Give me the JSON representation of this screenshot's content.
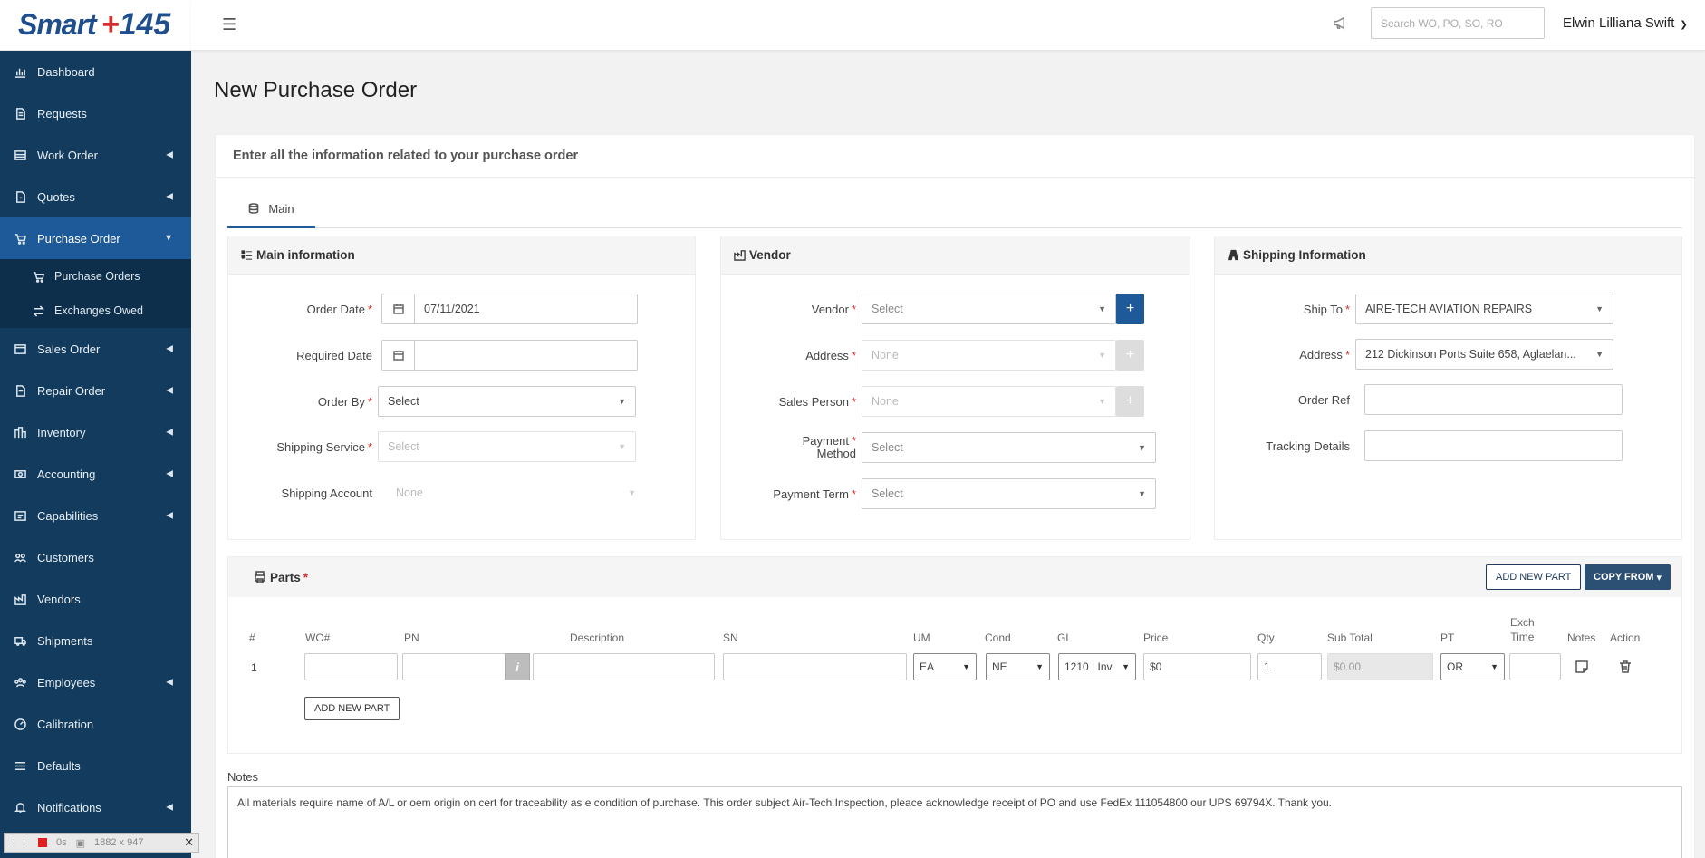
{
  "brand": {
    "name_part1": "Smart",
    "name_plus": "+",
    "name_part2": "145"
  },
  "topbar": {
    "search_placeholder": "Search WO, PO, SO, RO",
    "user_name": "Elwin Lilliana Swift"
  },
  "sidebar": {
    "items": [
      {
        "label": "Dashboard",
        "icon": "chart-icon",
        "chevron": false
      },
      {
        "label": "Requests",
        "icon": "document-icon",
        "chevron": false
      },
      {
        "label": "Work Order",
        "icon": "list-icon",
        "chevron": true
      },
      {
        "label": "Quotes",
        "icon": "quote-icon",
        "chevron": true
      },
      {
        "label": "Purchase Order",
        "icon": "cart-icon",
        "chevron": true,
        "active": true
      },
      {
        "label": "Sales Order",
        "icon": "sales-icon",
        "chevron": true
      },
      {
        "label": "Repair Order",
        "icon": "repair-icon",
        "chevron": true
      },
      {
        "label": "Inventory",
        "icon": "inventory-icon",
        "chevron": true
      },
      {
        "label": "Accounting",
        "icon": "accounting-icon",
        "chevron": true
      },
      {
        "label": "Capabilities",
        "icon": "capabilities-icon",
        "chevron": true
      },
      {
        "label": "Customers",
        "icon": "customers-icon",
        "chevron": false
      },
      {
        "label": "Vendors",
        "icon": "vendors-icon",
        "chevron": false
      },
      {
        "label": "Shipments",
        "icon": "truck-icon",
        "chevron": false
      },
      {
        "label": "Employees",
        "icon": "employees-icon",
        "chevron": true
      },
      {
        "label": "Calibration",
        "icon": "gauge-icon",
        "chevron": false
      },
      {
        "label": "Defaults",
        "icon": "menu-icon",
        "chevron": false
      },
      {
        "label": "Notifications",
        "icon": "bell-icon",
        "chevron": true
      }
    ],
    "submenu": [
      {
        "label": "Purchase Orders",
        "icon": "cart-icon"
      },
      {
        "label": "Exchanges Owed",
        "icon": "exchange-icon"
      }
    ]
  },
  "page": {
    "title": "New Purchase Order",
    "subtitle": "Enter all the information related to your purchase order",
    "tab": "Main"
  },
  "main_info": {
    "title": "Main information",
    "order_date_label": "Order Date",
    "order_date_value": "07/11/2021",
    "required_date_label": "Required Date",
    "order_by_label": "Order By",
    "order_by_value": "Select",
    "shipping_service_label": "Shipping Service",
    "shipping_service_value": "Select",
    "shipping_account_label": "Shipping Account",
    "shipping_account_value": "None"
  },
  "vendor": {
    "title": "Vendor",
    "vendor_label": "Vendor",
    "vendor_value": "Select",
    "address_label": "Address",
    "address_value": "None",
    "sales_person_label": "Sales Person",
    "sales_person_value": "None",
    "payment_method_label_1": "Payment",
    "payment_method_label_2": "Method",
    "payment_method_value": "Select",
    "payment_term_label": "Payment Term",
    "payment_term_value": "Select"
  },
  "shipping": {
    "title": "Shipping Information",
    "ship_to_label": "Ship To",
    "ship_to_value": "AIRE-TECH AVIATION REPAIRS",
    "address_label": "Address",
    "address_value": "212 Dickinson Ports Suite 658, Aglaelan...",
    "order_ref_label": "Order Ref",
    "tracking_label": "Tracking Details"
  },
  "parts": {
    "title": "Parts",
    "add_new_part": "ADD NEW PART",
    "copy_from": "COPY FROM",
    "columns": {
      "num": "#",
      "wo": "WO#",
      "pn": "PN",
      "desc": "Description",
      "sn": "SN",
      "um": "UM",
      "cond": "Cond",
      "gl": "GL",
      "price": "Price",
      "qty": "Qty",
      "subtotal": "Sub Total",
      "pt": "PT",
      "exch1": "Exch",
      "exch2": "Time",
      "notes": "Notes",
      "action": "Action"
    },
    "row": {
      "num": "1",
      "um": "EA",
      "cond": "NE",
      "gl": "1210 | Inv",
      "price": "$0",
      "qty": "1",
      "subtotal": "$0.00",
      "pt": "OR"
    },
    "add_row_button": "ADD NEW PART"
  },
  "notes": {
    "label": "Notes",
    "text": "All materials require name of A/L or oem origin on cert for traceability as e condition of purchase. This order subject Air-Tech Inspection, pleace acknowledge receipt of PO and use FedEx 111054800 our UPS 69794X. Thank you."
  },
  "recorder": {
    "time": "0s",
    "size": "1882 x 947"
  },
  "colors": {
    "sidebar": "#123b5d",
    "active": "#1e5a99",
    "required": "#d42e2e"
  }
}
